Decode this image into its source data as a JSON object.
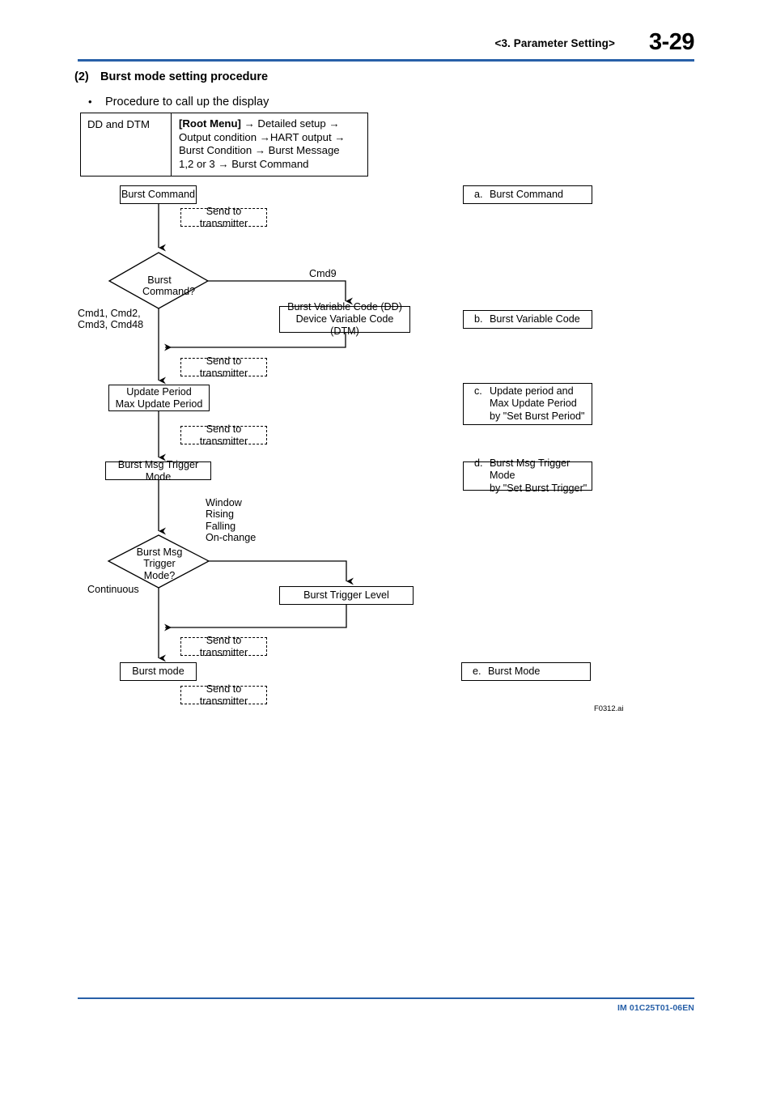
{
  "header": {
    "chapter": "<3.  Parameter Setting>",
    "page_number": "3-29",
    "rule_color": "#2860a8"
  },
  "section": {
    "number": "(2)",
    "title": "Burst mode setting procedure",
    "bullet_glyph": "•",
    "bullet_text": "Procedure to call up the display"
  },
  "menu_table": {
    "row_label": "DD and DTM",
    "path_bold": "[Root Menu]",
    "path_rest": " → Detailed setup →\nOutput condition →HART output →\nBurst Condition → Burst Message\n1,2 or 3 → Burst Command"
  },
  "flowchart": {
    "nodes": {
      "burst_command": "Burst Command",
      "burst_command_decision": "Burst\nCommand?",
      "burst_variable_code": "Burst Variable Code (DD)\nDevice Variable Code (DTM)",
      "update_period": "Update Period\nMax Update Period",
      "burst_msg_trigger_mode": "Burst Msg Trigger Mode",
      "burst_msg_trigger_decision": "Burst Msg\nTrigger Mode?",
      "burst_trigger_level": "Burst Trigger Level",
      "burst_mode": "Burst mode",
      "send_to_transmitter": "Send to transmitter"
    },
    "edge_labels": {
      "cmd9": "Cmd9",
      "cmd_list": "Cmd1, Cmd2,\nCmd3, Cmd48",
      "trigger_options": "Window\nRising\nFalling\nOn-change",
      "continuous": "Continuous"
    },
    "reference_boxes": [
      {
        "key": "a.",
        "lines": [
          "Burst Command"
        ]
      },
      {
        "key": "b.",
        "lines": [
          "Burst Variable Code"
        ]
      },
      {
        "key": "c.",
        "lines": [
          "Update period and",
          "Max Update Period",
          "by \"Set Burst Period\""
        ]
      },
      {
        "key": "d.",
        "lines": [
          "Burst Msg Trigger Mode",
          "by \"Set Burst Trigger\""
        ]
      },
      {
        "key": "e.",
        "lines": [
          "Burst Mode"
        ]
      }
    ],
    "figure_reference": "F0312.ai"
  },
  "footer": {
    "document_number": "IM 01C25T01-06EN"
  }
}
